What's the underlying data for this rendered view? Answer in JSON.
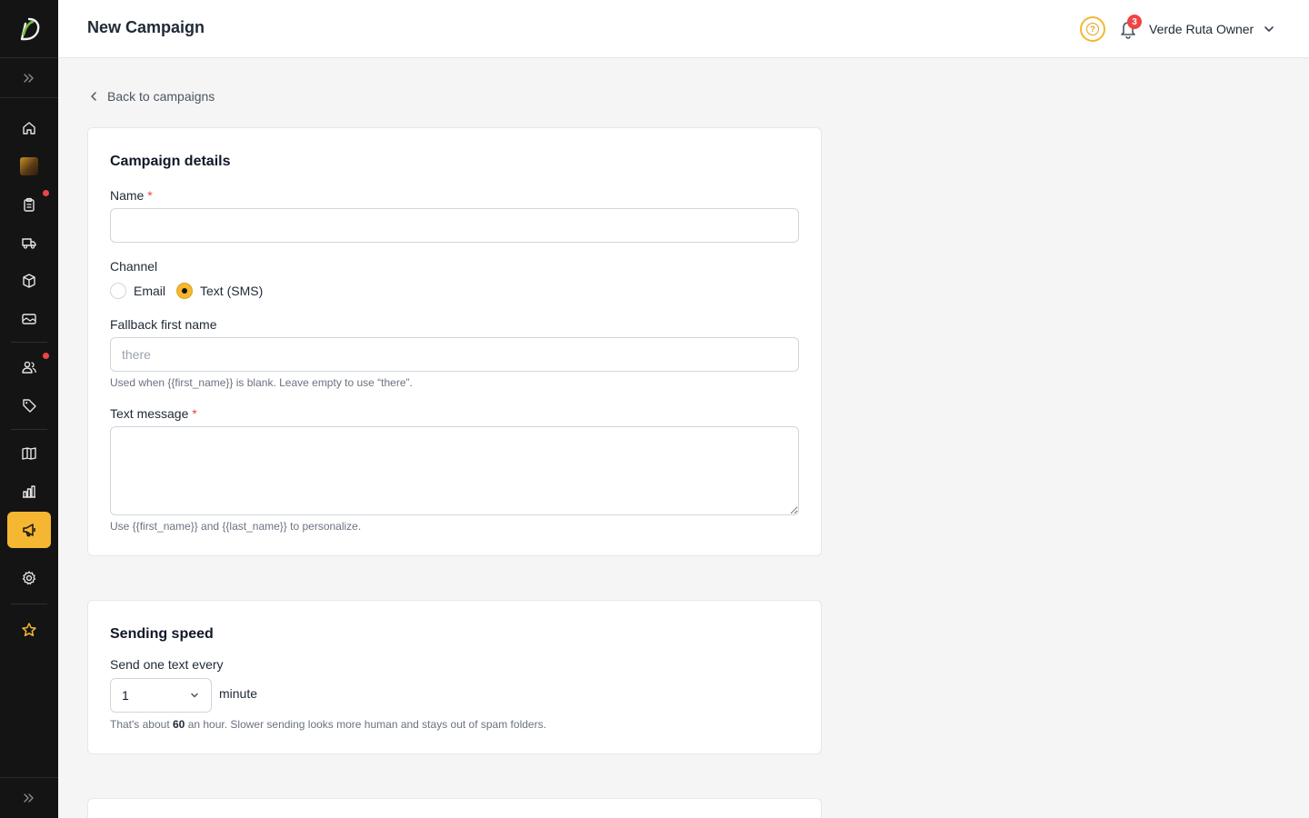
{
  "header": {
    "title": "New Campaign",
    "notification_count": "3",
    "user_name": "Verde Ruta Owner",
    "help_glyph": "?"
  },
  "sidebar": {
    "active_item": "campaigns",
    "items": [
      {
        "name": "home",
        "icon": "home-icon"
      },
      {
        "name": "brand",
        "icon": "brand-thumbnail"
      },
      {
        "name": "orders",
        "icon": "clipboard-icon",
        "has_notification": true
      },
      {
        "name": "delivery",
        "icon": "truck-icon"
      },
      {
        "name": "products",
        "icon": "box-icon"
      },
      {
        "name": "gallery",
        "icon": "image-icon"
      },
      {
        "name": "customers",
        "icon": "users-icon",
        "has_notification": true
      },
      {
        "name": "tags",
        "icon": "tag-icon"
      },
      {
        "name": "catalog",
        "icon": "book-icon"
      },
      {
        "name": "analytics",
        "icon": "bar-chart-icon"
      },
      {
        "name": "campaigns",
        "icon": "megaphone-icon"
      },
      {
        "name": "settings",
        "icon": "gear-icon"
      },
      {
        "name": "favorites",
        "icon": "star-icon"
      }
    ]
  },
  "back_link": "Back to campaigns",
  "campaign_details": {
    "title": "Campaign details",
    "name_label": "Name",
    "required_mark": "*",
    "name_value": "",
    "channel_label": "Channel",
    "channel_options": [
      "Email",
      "Text (SMS)"
    ],
    "channel_selected": "Text (SMS)",
    "fallback_label": "Fallback first name",
    "fallback_placeholder": "there",
    "fallback_hint": "Used when {{first_name}} is blank. Leave empty to use “there”.",
    "message_label": "Text message",
    "message_value": "",
    "message_hint": "Use {{first_name}} and {{last_name}} to personalize."
  },
  "sending_speed": {
    "title": "Sending speed",
    "label": "Send one text every",
    "interval_value": "1",
    "interval_unit": "minute",
    "hint_prefix": "That's about ",
    "hint_rate": "60",
    "hint_suffix": " an hour. Slower sending looks more human and stays out of spam folders."
  },
  "colors": {
    "accent": "#f5b731",
    "sidebar_bg": "#141414",
    "badge": "#ef4444",
    "page_bg": "#f5f5f5"
  }
}
